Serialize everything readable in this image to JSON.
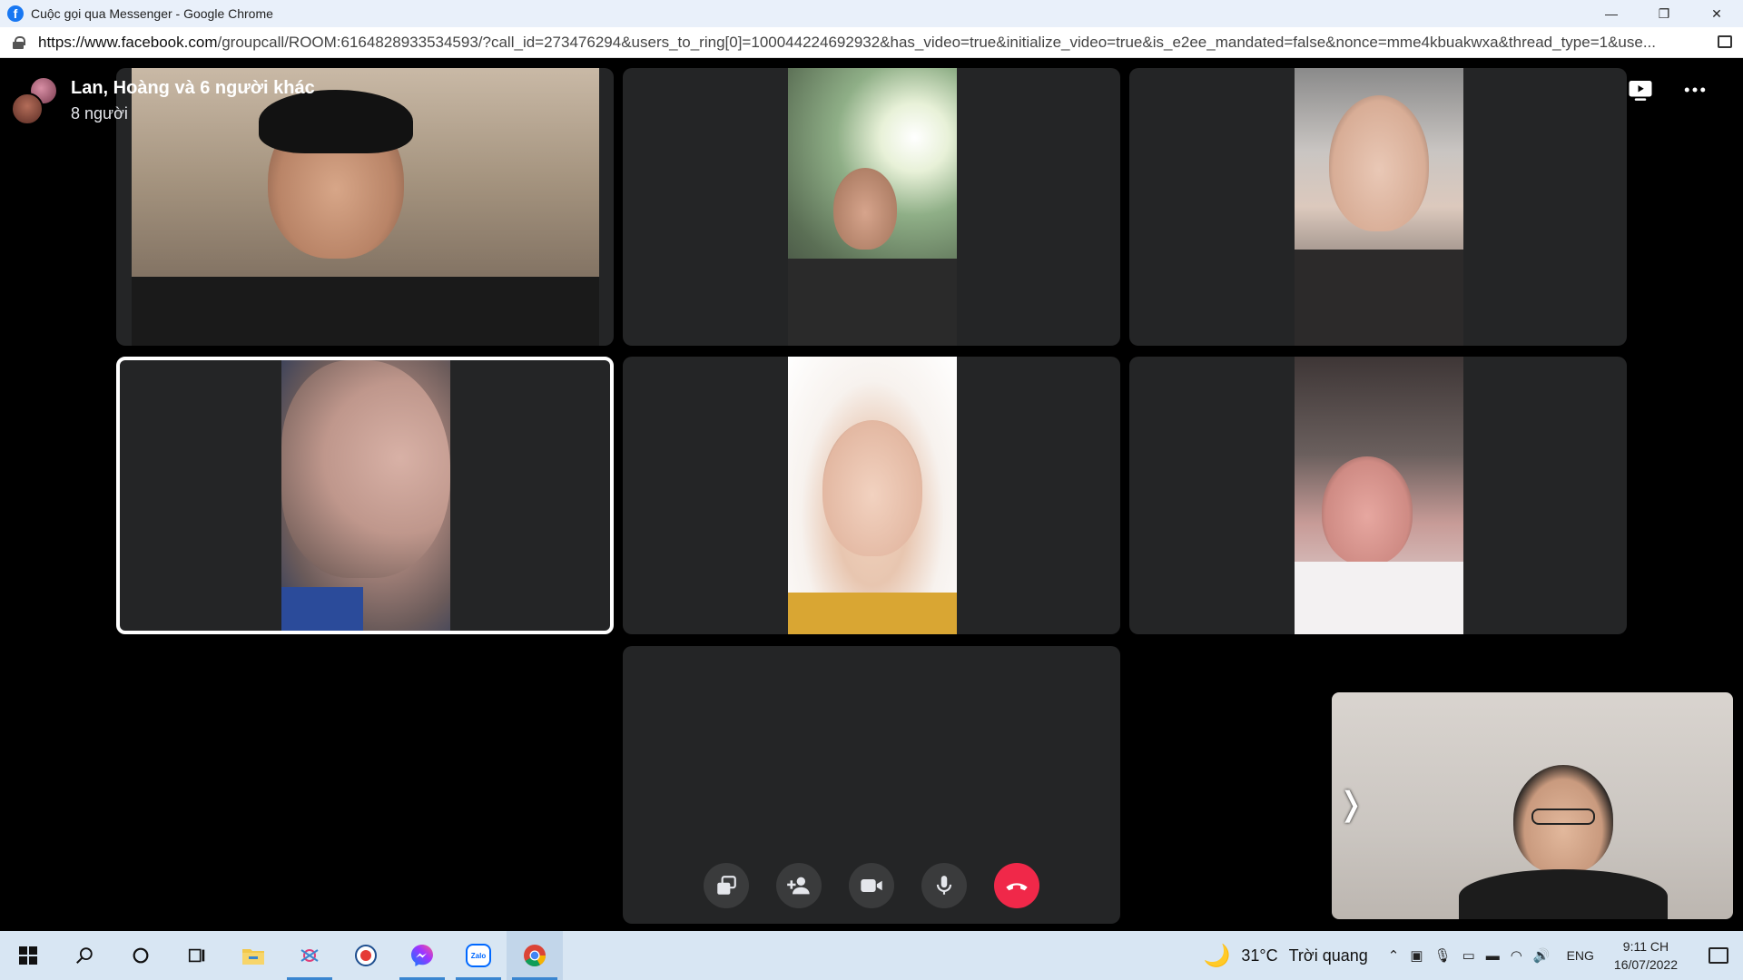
{
  "browser": {
    "window_title": "Cuộc gọi qua Messenger - Google Chrome",
    "url_host": "https://www.facebook.com",
    "url_path": "/groupcall/ROOM:6164828933534593/?call_id=273476294&users_to_ring[0]=100044224692932&has_video=true&initialize_video=true&is_e2ee_mandated=false&nonce=mme4kbuakwxa&thread_type=1&use...",
    "controls": {
      "minimize": "—",
      "restore": "❐",
      "close": "✕"
    }
  },
  "call": {
    "group_name": "Lan, Hoàng và 6 người khác",
    "participant_count": "8 người",
    "top_icons": [
      "raise-hand-icon",
      "screen-share-icon",
      "more-options-icon"
    ],
    "selfview_chevron": "❭",
    "controls": [
      {
        "name": "switch-view-button",
        "icon": "gallery-icon"
      },
      {
        "name": "add-person-button",
        "icon": "add-person-icon"
      },
      {
        "name": "camera-button",
        "icon": "camera-icon"
      },
      {
        "name": "mic-button",
        "icon": "mic-icon"
      },
      {
        "name": "end-call-button",
        "icon": "phone-hangup-icon"
      }
    ],
    "end_call_color": "#f02849"
  },
  "taskbar": {
    "weather_temp": "31°C",
    "weather_text": "Trời quang",
    "language": "ENG",
    "time": "9:11 CH",
    "date": "16/07/2022",
    "apps": [
      "start-icon",
      "search-icon",
      "cortana-icon",
      "task-view-icon",
      "file-explorer-icon",
      "app-icon",
      "app-icon",
      "messenger-icon",
      "zalo-icon",
      "chrome-icon"
    ],
    "zalo_label": "Zalo"
  }
}
